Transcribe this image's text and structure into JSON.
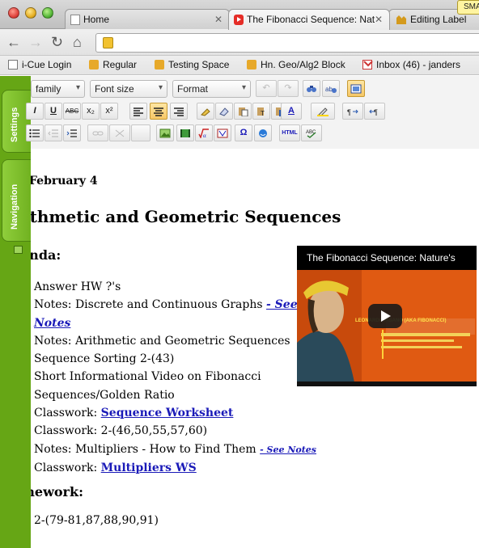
{
  "browser": {
    "tabs": [
      {
        "label": "Home"
      },
      {
        "label": "The Fibonacci Sequence: Nat"
      },
      {
        "label": "Editing Label"
      }
    ],
    "notice_badge": "SMA"
  },
  "bookmarks": [
    {
      "label": "i-Cue Login"
    },
    {
      "label": "Regular"
    },
    {
      "label": "Testing Space"
    },
    {
      "label": "Hn. Geo/Alg2 Block"
    },
    {
      "label": "Inbox (46) - janders"
    }
  ],
  "side_panel": {
    "settings_label": "Settings",
    "navigation_label": "Navigation"
  },
  "editor_toolbar": {
    "font_family": "family",
    "font_size": "Font size",
    "format": "Format",
    "bold": "B",
    "italic": "I",
    "underline": "U",
    "strike": "ABC",
    "subscript": "x₂",
    "superscript": "x²",
    "omega": "Ω",
    "html": "HTML",
    "text_color": "A"
  },
  "content": {
    "date": "February 4",
    "title": "ithmetic and Geometric Sequences",
    "agenda_heading": "enda:",
    "agenda": {
      "item1": "Answer HW ?'s",
      "item2_text": "Notes: Discrete and Continuous Graphs ",
      "item2_link_a": "- See",
      "item2_link_b": "Notes",
      "item3": "Notes: Arithmetic and Geometric Sequences",
      "item4": "Sequence Sorting 2-(43)",
      "item5a": "Short Informational Video on Fibonacci",
      "item5b": "Sequences/Golden Ratio",
      "item6_text": "Classwork: ",
      "item6_link": "Sequence Worksheet",
      "item7": "Classwork: 2-(46,50,55,57,60)",
      "item8_text": "Notes: Multipliers - How to Find Them ",
      "item8_link": "- See Notes",
      "item9_text": "Classwork: ",
      "item9_link": "Multipliers WS"
    },
    "homework_heading": "mework:",
    "homework_item": "2-(79-81,87,88,90,91)"
  },
  "video": {
    "title": "The Fibonacci Sequence: Nature's",
    "banner_text": "LEONARDO PISANO (AKA FIBONACCI)"
  },
  "colors": {
    "side_panel": "#66a615",
    "link": "#1a1ab8",
    "video_bg": "#e05a12"
  }
}
